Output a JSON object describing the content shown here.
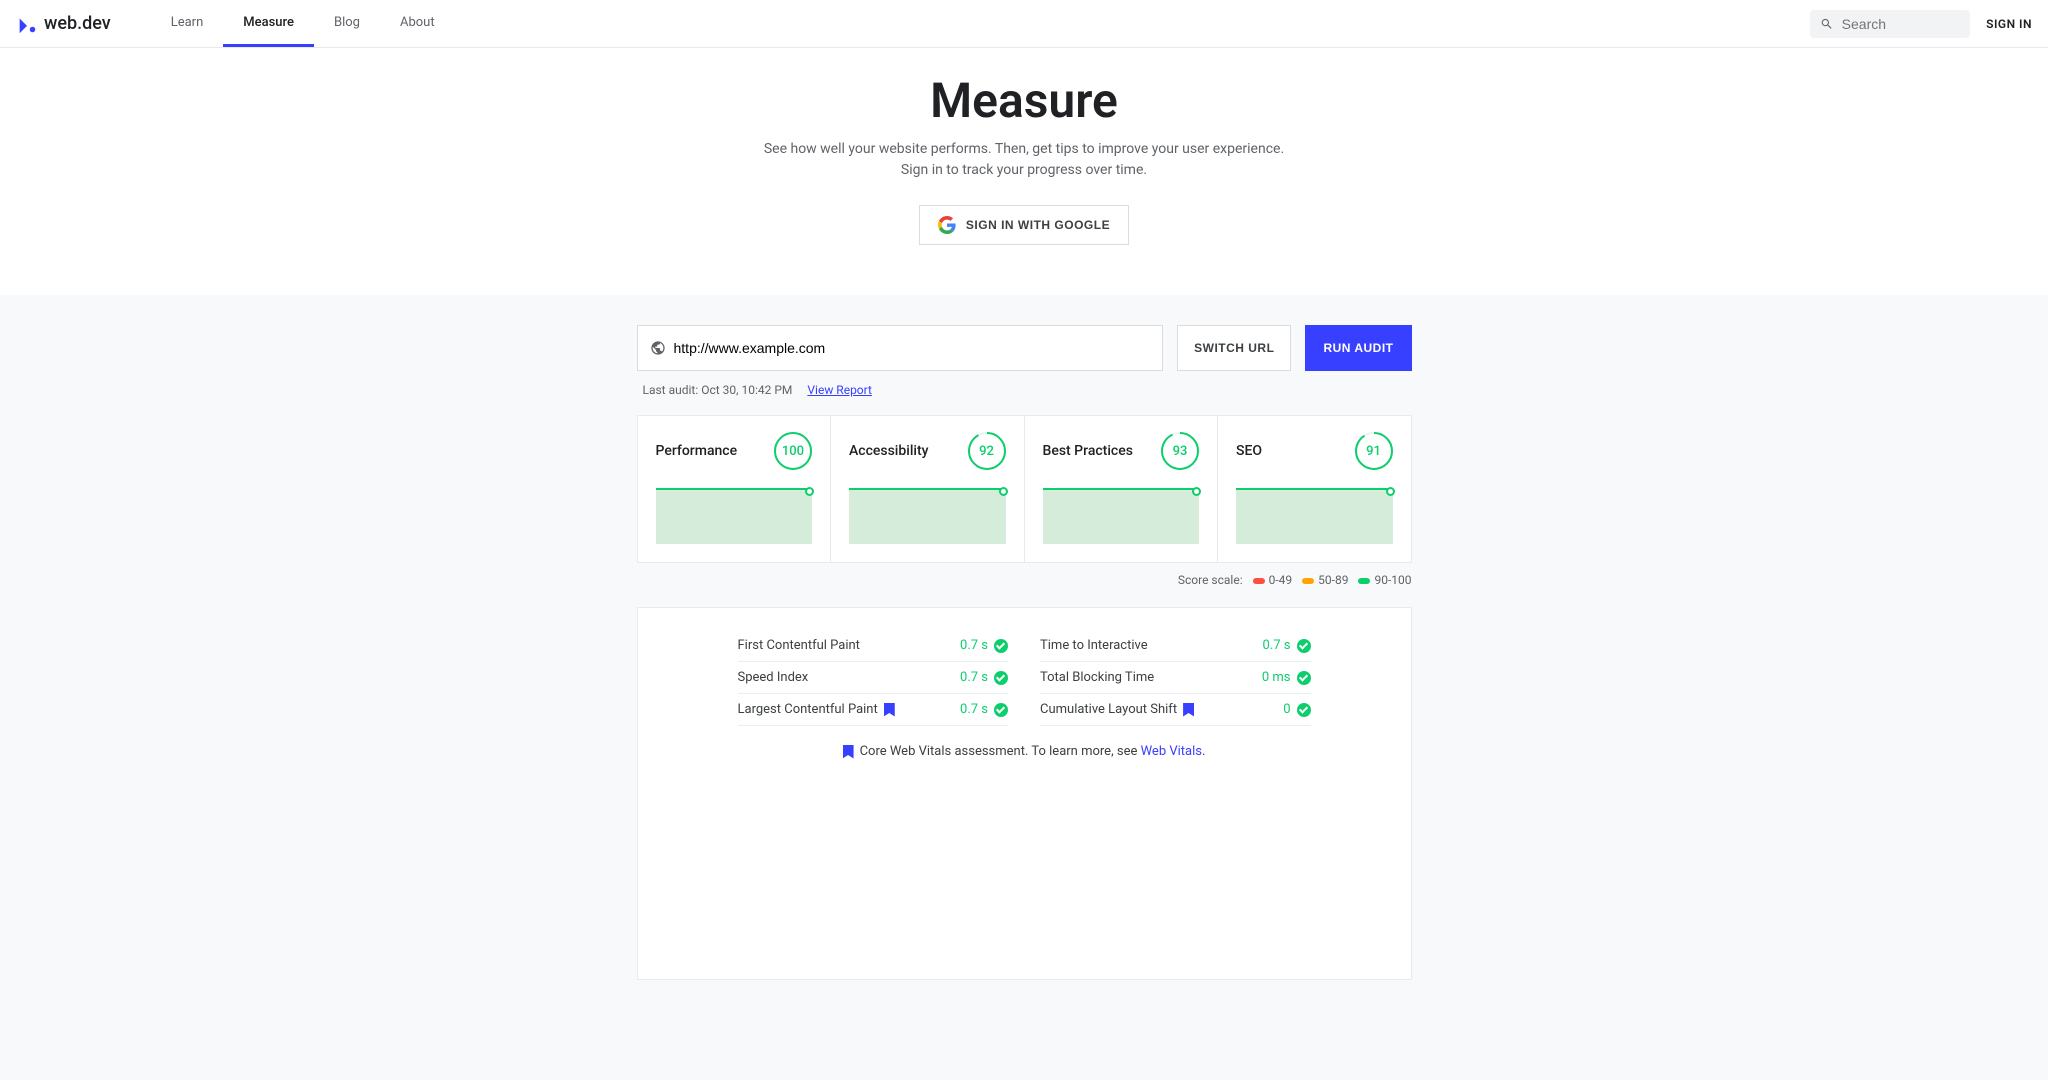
{
  "header": {
    "brand": "web.dev",
    "nav": [
      {
        "label": "Learn",
        "active": false
      },
      {
        "label": "Measure",
        "active": true
      },
      {
        "label": "Blog",
        "active": false
      },
      {
        "label": "About",
        "active": false
      }
    ],
    "search_placeholder": "Search",
    "sign_in": "SIGN IN"
  },
  "hero": {
    "title": "Measure",
    "subtitle": "See how well your website performs. Then, get tips to improve your user experience. Sign in to track your progress over time.",
    "google_button": "SIGN IN WITH GOOGLE"
  },
  "audit": {
    "url_value": "http://www.example.com",
    "switch_url": "SWITCH URL",
    "run_audit": "RUN AUDIT",
    "last_audit_prefix": "Last audit: Oct 30, 10:42 PM",
    "view_report": "View Report"
  },
  "scores": [
    {
      "label": "Performance",
      "value": "100",
      "frac": 1.0
    },
    {
      "label": "Accessibility",
      "value": "92",
      "frac": 0.92
    },
    {
      "label": "Best Practices",
      "value": "93",
      "frac": 0.93
    },
    {
      "label": "SEO",
      "value": "91",
      "frac": 0.91
    }
  ],
  "scale": {
    "label": "Score scale:",
    "ranges": [
      {
        "text": "0-49",
        "color": "#ff4e42"
      },
      {
        "text": "50-89",
        "color": "#ffa400"
      },
      {
        "text": "90-100",
        "color": "#0cce6b"
      }
    ]
  },
  "metrics": {
    "left": [
      {
        "name": "First Contentful Paint",
        "value": "0.7 s",
        "bookmark": false
      },
      {
        "name": "Speed Index",
        "value": "0.7 s",
        "bookmark": false
      },
      {
        "name": "Largest Contentful Paint",
        "value": "0.7 s",
        "bookmark": true
      }
    ],
    "right": [
      {
        "name": "Time to Interactive",
        "value": "0.7 s",
        "bookmark": false
      },
      {
        "name": "Total Blocking Time",
        "value": "0 ms",
        "bookmark": false
      },
      {
        "name": "Cumulative Layout Shift",
        "value": "0",
        "bookmark": true
      }
    ]
  },
  "core_vitals": {
    "text": "Core Web Vitals assessment. To learn more, see ",
    "link": "Web Vitals",
    "suffix": "."
  },
  "chart_data": [
    {
      "type": "line",
      "title": "Performance",
      "values": [
        100
      ],
      "ylim": [
        0,
        100
      ]
    },
    {
      "type": "line",
      "title": "Accessibility",
      "values": [
        92
      ],
      "ylim": [
        0,
        100
      ]
    },
    {
      "type": "line",
      "title": "Best Practices",
      "values": [
        93
      ],
      "ylim": [
        0,
        100
      ]
    },
    {
      "type": "line",
      "title": "SEO",
      "values": [
        91
      ],
      "ylim": [
        0,
        100
      ]
    }
  ]
}
